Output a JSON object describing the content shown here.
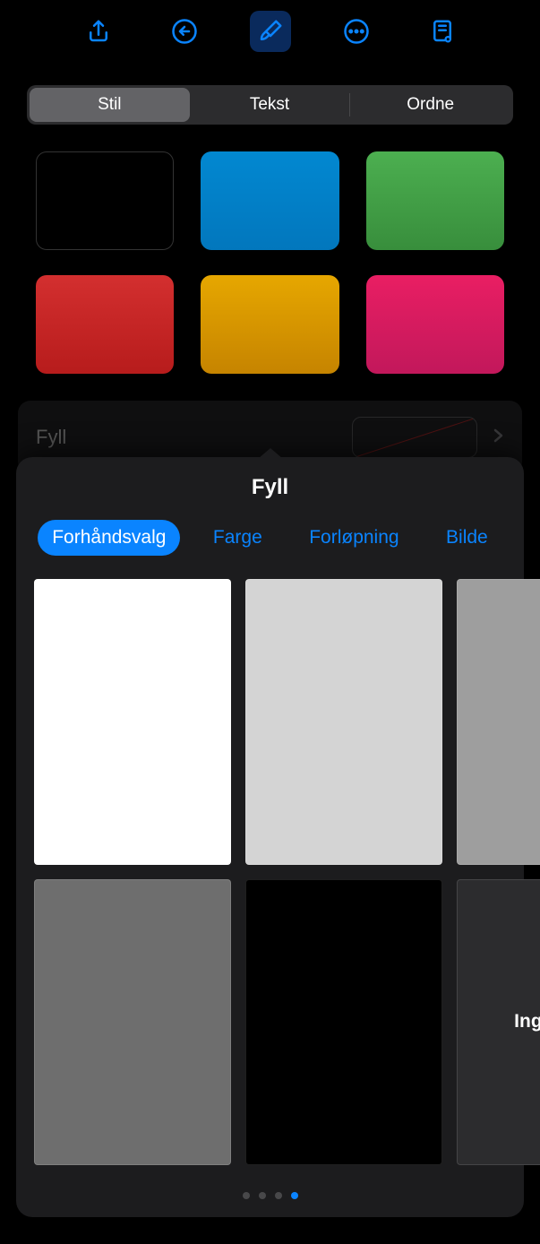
{
  "segments": {
    "style": "Stil",
    "text": "Tekst",
    "arrange": "Ordne"
  },
  "colors": {
    "black": "#000000",
    "blue": "#0288d1",
    "green": "#4caf50",
    "red": "#d32f2f",
    "orange": "#e6a700",
    "pink": "#e91e63"
  },
  "fill_row": {
    "label": "Fyll"
  },
  "popup": {
    "title": "Fyll",
    "tabs": {
      "preset": "Forhåndsvalg",
      "color": "Farge",
      "gradient": "Forløpning",
      "image": "Bilde"
    },
    "presets": {
      "white": "#ffffff",
      "light_gray": "#d4d4d4",
      "gray": "#9e9e9e",
      "dark_gray": "#6e6e6e",
      "black": "#000000",
      "none_bg": "#2c2c2e",
      "none_label": "Ingen fyll"
    },
    "active_page": 3,
    "total_pages": 4
  }
}
